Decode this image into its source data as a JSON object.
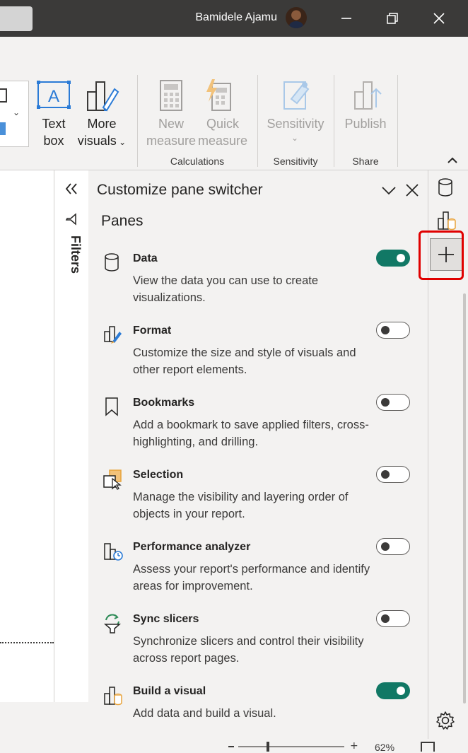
{
  "titlebar": {
    "username": "Bamidele Ajamu",
    "buttons": [
      "minimize-icon",
      "restore-icon",
      "close-icon"
    ]
  },
  "ribbon": {
    "text_box": {
      "line1": "Text",
      "line2": "box"
    },
    "more_visuals": {
      "line1": "More",
      "line2": "visuals"
    },
    "new_measure": {
      "line1": "New",
      "line2": "measure"
    },
    "quick_measure": {
      "line1": "Quick",
      "line2": "measure"
    },
    "sensitivity": {
      "label": "Sensitivity"
    },
    "publish": {
      "label": "Publish"
    },
    "groups": {
      "calculations": "Calculations",
      "sensitivity": "Sensitivity",
      "share": "Share"
    }
  },
  "filters": {
    "label": "Filters"
  },
  "pane": {
    "title": "Customize pane switcher",
    "heading": "Panes",
    "items": [
      {
        "title": "Data",
        "desc": "View the data you can use to create visualizations.",
        "enabled": true,
        "icon": "data-icon"
      },
      {
        "title": "Format",
        "desc": "Customize the size and style of visuals and other report elements.",
        "enabled": false,
        "icon": "format-icon"
      },
      {
        "title": "Bookmarks",
        "desc": "Add a bookmark to save applied filters, cross-highlighting, and drilling.",
        "enabled": false,
        "icon": "bookmark-icon"
      },
      {
        "title": "Selection",
        "desc": "Manage the visibility and layering order of objects in your report.",
        "enabled": false,
        "icon": "selection-icon"
      },
      {
        "title": "Performance analyzer",
        "desc": "Assess your report's performance and identify areas for improvement.",
        "enabled": false,
        "icon": "performance-icon"
      },
      {
        "title": "Sync slicers",
        "desc": "Synchronize slicers and control their visibility across report pages.",
        "enabled": false,
        "icon": "sync-slicers-icon"
      },
      {
        "title": "Build a visual",
        "desc": "Add data and build a visual.",
        "enabled": true,
        "icon": "build-visual-icon"
      }
    ]
  },
  "status": {
    "zoom": "62%"
  },
  "colors": {
    "toggle_on": "#117865",
    "highlight": "#e00000",
    "titlebar": "#3b3a39"
  }
}
